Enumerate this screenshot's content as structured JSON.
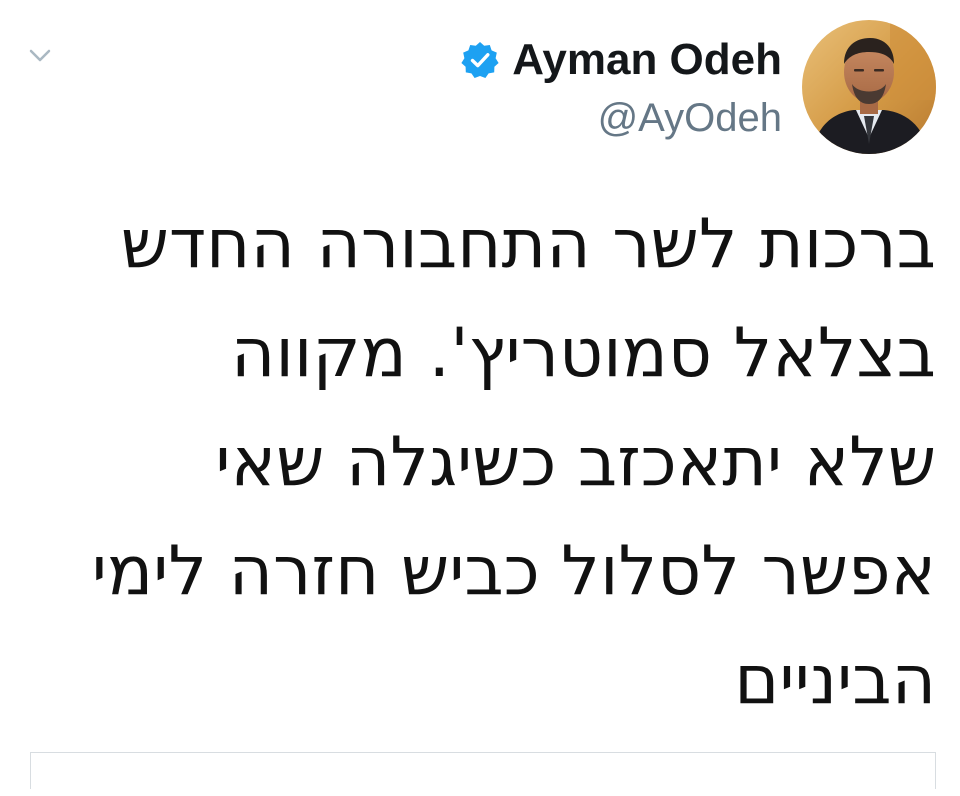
{
  "tweet": {
    "author": {
      "display_name": "Ayman Odeh",
      "handle": "@AyOdeh",
      "verified": true,
      "verified_icon": "verified-badge-icon",
      "verified_color": "#1da1f2"
    },
    "menu_icon": "chevron-down-icon",
    "text_lines": [
      "ברכות לשר התחבורה החדש",
      "בצלאל סמוטריץ'. מקווה",
      "שלא יתאכזב כשיגלה שאי",
      "אפשר לסלול כביש חזרה לימי",
      "הביניים"
    ]
  },
  "colors": {
    "name": "#14171a",
    "handle": "#657786",
    "text": "#111111",
    "border": "#d8dde1",
    "chevron": "#aab8c2"
  }
}
